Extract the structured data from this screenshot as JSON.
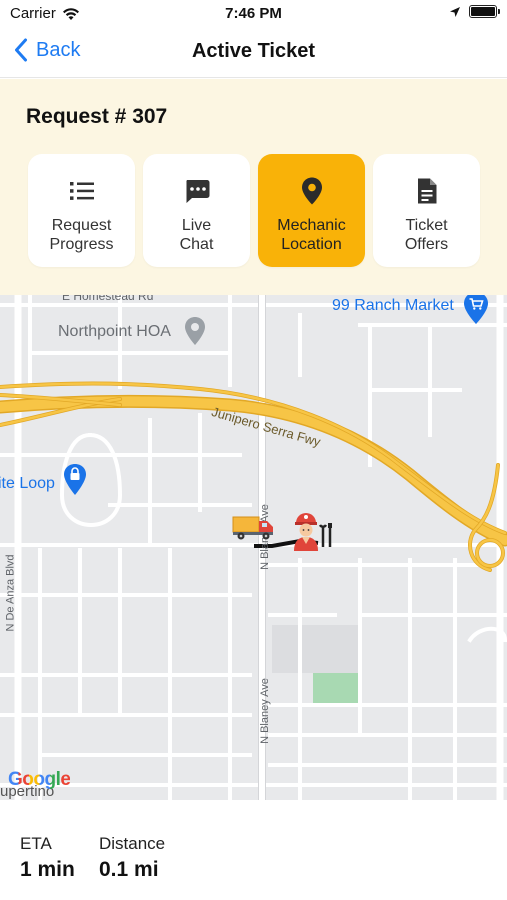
{
  "status_bar": {
    "carrier": "Carrier",
    "time": "7:46 PM",
    "battery_level": 1.0
  },
  "nav": {
    "back_label": "Back",
    "title": "Active Ticket"
  },
  "request": {
    "title": "Request # 307",
    "tabs": [
      {
        "label": "Request\nProgress",
        "icon": "list-icon",
        "active": false
      },
      {
        "label": "Live\nChat",
        "icon": "chat-bubble-icon",
        "active": false
      },
      {
        "label": "Mechanic\nLocation",
        "icon": "location-pin-icon",
        "active": true
      },
      {
        "label": "Ticket\nOffers",
        "icon": "document-icon",
        "active": false
      }
    ]
  },
  "map": {
    "street_labels": {
      "homestead": "E Homestead Rd",
      "junipero": "Junipero Serra Fwy",
      "de_anza": "N De Anza Blvd",
      "blaney_top": "N Blaney Ave",
      "blaney_bottom": "N Blaney Ave",
      "cupertino": "upertino"
    },
    "poi": {
      "northpoint": "Northpoint HOA",
      "ranch_market": "99 Ranch Market",
      "loop": "ite Loop"
    },
    "google_logo": "Google",
    "colors": {
      "freeway": "#f7c546",
      "freeway_edge": "#e2a826",
      "road": "#ffffff",
      "park": "#a8d9b2",
      "poi_blue": "#1a73e8",
      "poi_gray": "#9aa0a6"
    }
  },
  "metrics": {
    "eta_label": "ETA",
    "eta_value": "1 min",
    "distance_label": "Distance",
    "distance_value": "0.1 mi"
  },
  "colors": {
    "accent": "#f9b208",
    "link_blue": "#1e7bf2",
    "panel_bg": "#fcf6e2"
  }
}
